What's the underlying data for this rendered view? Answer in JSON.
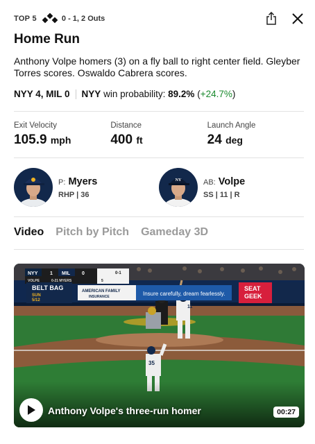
{
  "header": {
    "inning": "TOP 5",
    "bases": {
      "first": true,
      "second": true,
      "third": true
    },
    "count": "0 - 1, 2 Outs"
  },
  "play": {
    "title": "Home Run",
    "description": "Anthony Volpe homers (3) on a fly ball to right center field. Gleyber Torres scores. Oswaldo Cabrera scores.",
    "score": "NYY 4, MIL 0",
    "wp_team": "NYY",
    "wp_text": "win probability:",
    "wp_value": "89.2%",
    "wp_open": "(",
    "wp_delta": "+24.7%",
    "wp_close": ")"
  },
  "stats": [
    {
      "label": "Exit Velocity",
      "value": "105.9",
      "unit": "mph"
    },
    {
      "label": "Distance",
      "value": "400",
      "unit": "ft"
    },
    {
      "label": "Launch Angle",
      "value": "24",
      "unit": "deg"
    }
  ],
  "pitcher": {
    "role": "P:",
    "name": "Myers",
    "meta": "RHP | 36"
  },
  "batter": {
    "role": "AB:",
    "name": "Volpe",
    "meta": "SS | 11 | R"
  },
  "tabs": [
    "Video",
    "Pitch by Pitch",
    "Gameday 3D"
  ],
  "video": {
    "title": "Anthony Volpe's three-run homer",
    "duration": "00:27",
    "scorebug": {
      "away": "NYY",
      "away_score": "1",
      "home": "MIL",
      "home_score": "0",
      "count": "0-1",
      "batter_tag": "VOLPE",
      "pitcher_tag": "0-21 MYERS",
      "pitch_count": "5"
    },
    "signs": {
      "belt_bag": "BELT BAG",
      "belt_bag_day": "SUN",
      "belt_bag_date": "5/12",
      "american_family": "AMERICAN FAMILY",
      "insurance": "INSURANCE",
      "slogan": "Insure carefully, dream fearlessly.",
      "seat": "SEAT",
      "geek": "GEEK",
      "jersey": "11",
      "catcher_jersey": "35"
    }
  },
  "colors": {
    "accent_green": "#1a8a2e",
    "mil_navy": "#12284b",
    "seatgeek_red": "#d71f3c"
  }
}
